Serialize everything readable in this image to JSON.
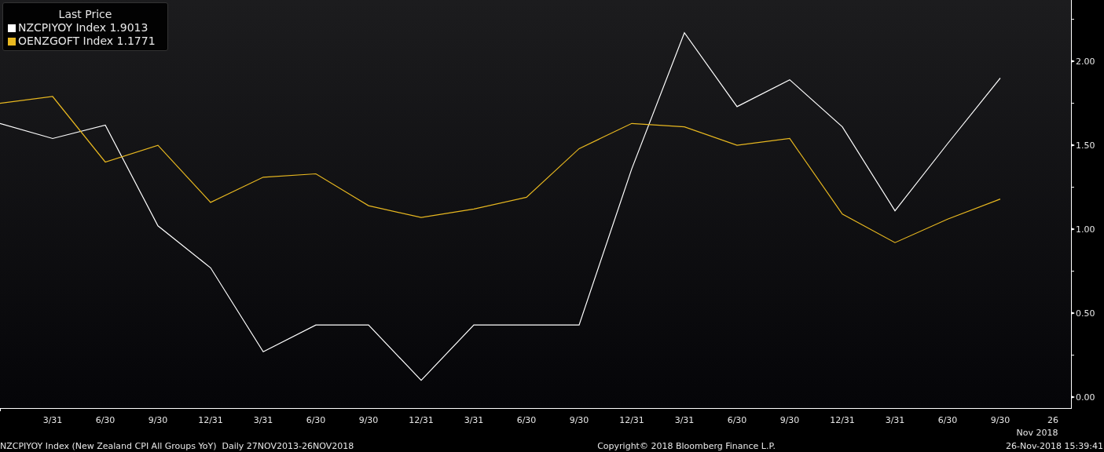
{
  "legend": {
    "title": "Last Price",
    "values": [
      "1.9013",
      "1.1771"
    ]
  },
  "chart_data": {
    "type": "line",
    "categories": [
      null,
      "3/31",
      "6/30",
      "9/30",
      "12/31",
      "3/31",
      "6/30",
      "9/30",
      "12/31",
      "3/31",
      "6/30",
      "9/30",
      "12/31",
      "3/31",
      "6/30",
      "9/30",
      "12/31",
      "3/31",
      "6/30",
      "9/30",
      "26"
    ],
    "series": [
      {
        "name": "NZCPIYOY Index",
        "color": "#ffffff",
        "values": [
          1.63,
          1.54,
          1.62,
          1.02,
          0.77,
          0.27,
          0.43,
          0.43,
          0.1,
          0.43,
          0.43,
          0.43,
          1.36,
          2.17,
          1.73,
          1.89,
          1.61,
          1.11,
          1.51,
          1.9,
          null
        ]
      },
      {
        "name": "OENZGOFT Index",
        "color": "#e8b820",
        "values": [
          1.75,
          1.79,
          1.4,
          1.5,
          1.16,
          1.31,
          1.33,
          1.14,
          1.07,
          1.12,
          1.19,
          1.48,
          1.63,
          1.61,
          1.5,
          1.54,
          1.09,
          0.92,
          1.06,
          1.18,
          null
        ]
      }
    ],
    "ylim": [
      -0.065,
      2.365
    ],
    "xlabel": "Nov 2018",
    "yticks": [
      {
        "value": 0,
        "label": "0.00"
      },
      {
        "value": 0.5,
        "label": "0.50"
      },
      {
        "value": 1,
        "label": "1.00"
      },
      {
        "value": 1.5,
        "label": "1.50"
      },
      {
        "value": 2,
        "label": "2.00"
      }
    ]
  },
  "footer": {
    "description": "NZCPIYOY Index (New Zealand CPI All Groups YoY)  Daily 27NOV2013-26NOV2018",
    "copyright": "Copyright© 2018 Bloomberg Finance L.P.",
    "timestamp": "26-Nov-2018 15:39:41"
  }
}
